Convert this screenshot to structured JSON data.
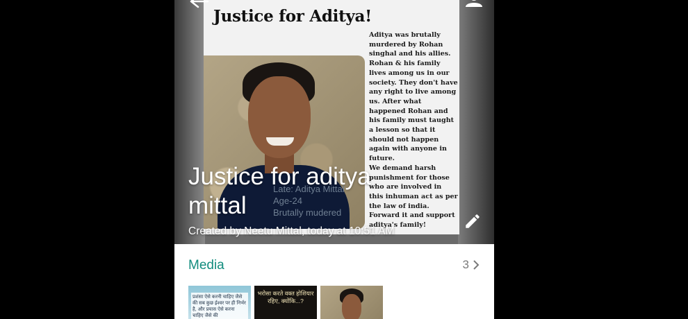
{
  "poster": {
    "title": "Justice for Aditya!",
    "body": "Aditya was brutally murdered by Rohan singhal and his allies. Rohan & his family lives among us in our society. They don't have any right to live among us. After what happened Rohan and his family must taught a lesson so that it should not happen again with anyone in future.\nWe demand harsh punishment for those who are involved in this inhuman act as per the law of india. Forward it and support aditya's family!",
    "caption_name": "Late: Aditya Mittal",
    "caption_age": "Age-24",
    "caption_fate": "Brutally mudered"
  },
  "group": {
    "name": "Justice for aditya mittal",
    "created_by": "Created by Neetu Mittal, today at 10:51 AM"
  },
  "media": {
    "label": "Media",
    "count": "3",
    "thumbs": [
      {
        "text": "प्रशंसा ऐसे करनी चाहिए जैसे की सब कुछ ईश्वर पर ही निर्भर है, और प्रयास ऐसे करना चाहिए जैसे की"
      },
      {
        "text": "भरोसा करते वक्त होशियार रहिए, क्योंकि...?"
      },
      {
        "text": ""
      }
    ]
  },
  "icons": {
    "back": "back-arrow-icon",
    "corner": "person-icon",
    "edit": "pencil-icon",
    "chevron": "chevron-right-icon"
  },
  "colors": {
    "accent": "#128c7e",
    "header_overlay": "#6a6a6a"
  }
}
